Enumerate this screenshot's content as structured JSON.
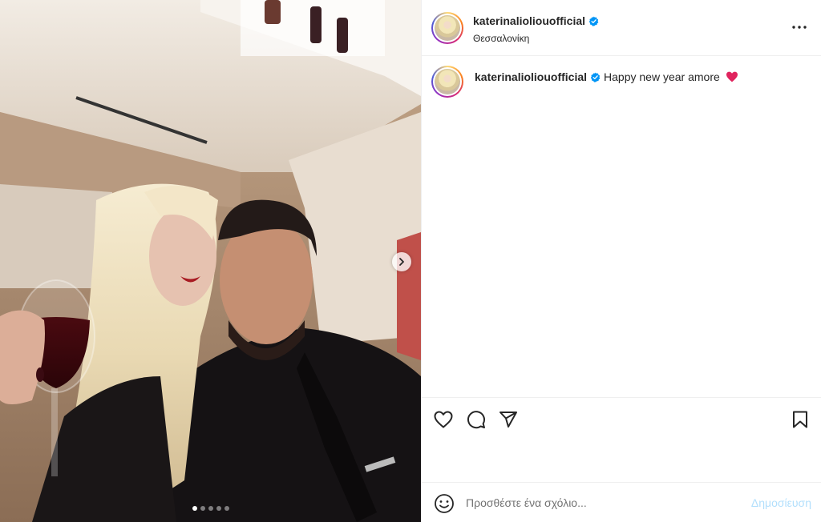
{
  "post": {
    "username": "katerinalioliouofficial",
    "location": "Θεσσαλονίκη",
    "caption": "Happy new year amore",
    "caption_emoji": "heart-emoji-icon",
    "carousel": {
      "total": 5,
      "current": 1
    }
  },
  "comment_box": {
    "placeholder": "Προσθέστε ένα σχόλιο...",
    "post_label": "Δημοσίευση"
  },
  "icons": {
    "verified": "verified-badge-icon",
    "more": "more-options-icon",
    "like": "heart-icon",
    "comment": "comment-icon",
    "share": "paper-plane-icon",
    "save": "bookmark-icon",
    "emoji": "smiley-icon",
    "next": "chevron-right-icon"
  },
  "colors": {
    "verified": "#0095f6",
    "post_button_disabled": "#b2dffc",
    "divider": "#efefef",
    "heart": "#e0245e"
  }
}
